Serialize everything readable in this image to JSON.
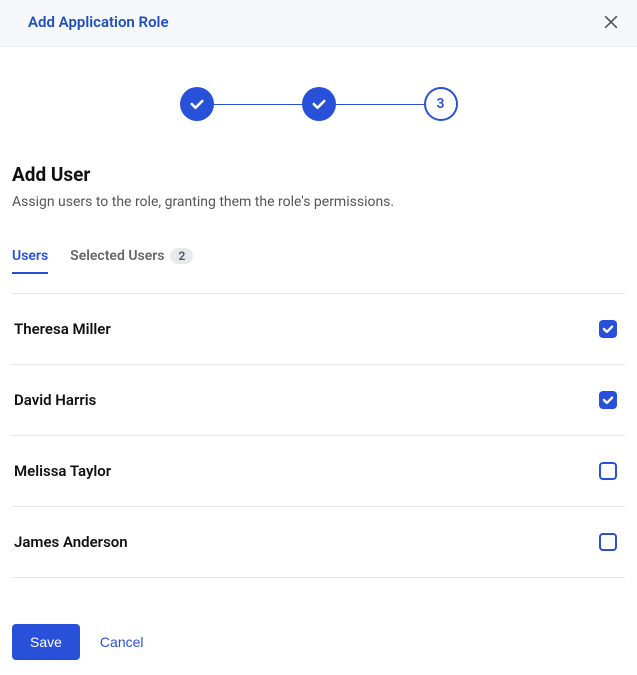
{
  "header": {
    "title": "Add Application Role"
  },
  "stepper": {
    "step1": "done",
    "step2": "done",
    "step3_label": "3"
  },
  "section": {
    "title": "Add User",
    "desc": "Assign users to the role, granting them the role's permissions."
  },
  "tabs": {
    "users": "Users",
    "selected": "Selected Users",
    "selected_count": "2"
  },
  "users": [
    {
      "name": "Theresa Miller",
      "checked": true
    },
    {
      "name": "David Harris",
      "checked": true
    },
    {
      "name": "Melissa Taylor",
      "checked": false
    },
    {
      "name": "James Anderson",
      "checked": false
    }
  ],
  "footer": {
    "save": "Save",
    "cancel": "Cancel"
  }
}
